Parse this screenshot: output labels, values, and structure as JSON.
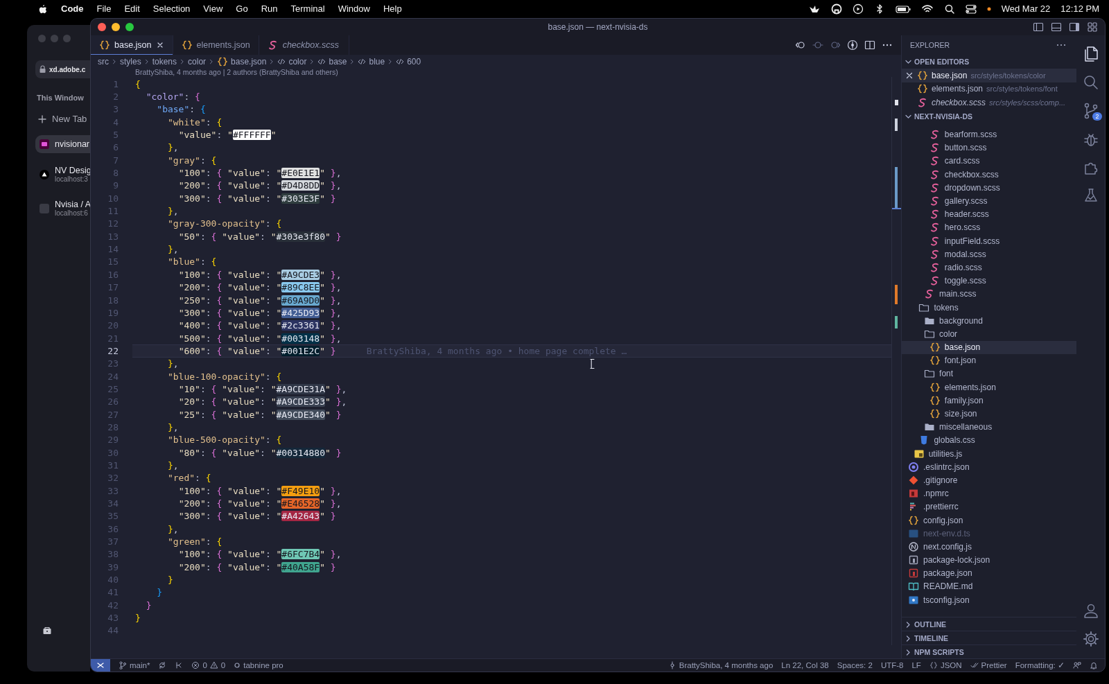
{
  "menubar": {
    "items": [
      {
        "label": "Code",
        "kind": "app"
      },
      {
        "label": "File",
        "kind": "menu"
      },
      {
        "label": "Edit",
        "kind": "menu"
      },
      {
        "label": "Selection",
        "kind": "menu"
      },
      {
        "label": "View",
        "kind": "menu"
      },
      {
        "label": "Go",
        "kind": "menu"
      },
      {
        "label": "Run",
        "kind": "menu"
      },
      {
        "label": "Terminal",
        "kind": "menu"
      },
      {
        "label": "Window",
        "kind": "menu"
      },
      {
        "label": "Help",
        "kind": "menu"
      }
    ],
    "date": "Wed Mar 22",
    "time": "12:12 PM"
  },
  "browser_sidebar": {
    "url": "xd.adobe.c",
    "section": "This Window",
    "new_tab": "New Tab",
    "tabs": [
      {
        "title": "nvisionar",
        "kind": "xd",
        "selected": true
      },
      {
        "title": "NV Desig",
        "subtitle": "localhost:3",
        "kind": "triangle",
        "selected": false
      },
      {
        "title": "Nvisia / A",
        "subtitle": "localhost:6",
        "kind": "blank",
        "selected": false
      }
    ]
  },
  "window": {
    "title": "base.json — next-nvisia-ds"
  },
  "tabs": [
    {
      "label": "base.json",
      "kind": "json",
      "selected": true,
      "preview": false
    },
    {
      "label": "elements.json",
      "kind": "json",
      "selected": false,
      "preview": false
    },
    {
      "label": "checkbox.scss",
      "kind": "scss",
      "selected": false,
      "preview": true
    }
  ],
  "breadcrumbs": [
    {
      "label": "src",
      "kind": "folder"
    },
    {
      "label": "styles",
      "kind": "folder"
    },
    {
      "label": "tokens",
      "kind": "folder"
    },
    {
      "label": "color",
      "kind": "folder"
    },
    {
      "label": "base.json",
      "kind": "json"
    },
    {
      "label": "color",
      "kind": "symbol"
    },
    {
      "label": "base",
      "kind": "symbol"
    },
    {
      "label": "blue",
      "kind": "symbol"
    },
    {
      "label": "600",
      "kind": "symbol"
    }
  ],
  "blame_header": "BrattyShiba, 4 months ago | 2 authors (BrattyShiba and others)",
  "lines": [
    {
      "number": "1",
      "code": "{",
      "current": false
    },
    {
      "number": "2",
      "code": "  \"color\": {",
      "current": false
    },
    {
      "number": "3",
      "code": "    \"base\": {",
      "current": false
    },
    {
      "number": "4",
      "code": "      \"white\": {",
      "current": false
    },
    {
      "number": "5",
      "code": "        \"value\": \"",
      "value": "#FFFFFF",
      "after": "\"",
      "color": "#ffffff",
      "current": false
    },
    {
      "number": "6",
      "code": "      },",
      "current": false
    },
    {
      "number": "7",
      "code": "      \"gray\": {",
      "current": false
    },
    {
      "number": "8",
      "code": "        \"100\": { \"value\": \"",
      "value": "#E0E1E1",
      "after": "\" },",
      "color": "#e0e1e1",
      "current": false
    },
    {
      "number": "9",
      "code": "        \"200\": { \"value\": \"",
      "value": "#D4D8DD",
      "after": "\" },",
      "color": "#d4d8dd",
      "current": false
    },
    {
      "number": "10",
      "code": "        \"300\": { \"value\": \"",
      "value": "#303E3F",
      "after": "\" }",
      "color": "#303e3f",
      "current": false
    },
    {
      "number": "11",
      "code": "      },",
      "current": false
    },
    {
      "number": "12",
      "code": "      \"gray-300-opacity\": {",
      "current": false
    },
    {
      "number": "13",
      "code": "        \"50\": { \"value\": \"",
      "value": "#303e3f80",
      "after": "\" }",
      "color": "#282f38",
      "current": false
    },
    {
      "number": "14",
      "code": "      },",
      "current": false
    },
    {
      "number": "15",
      "code": "      \"blue\": {",
      "current": false
    },
    {
      "number": "16",
      "code": "        \"100\": { \"value\": \"",
      "value": "#A9CDE3",
      "after": "\" },",
      "color": "#a9cde3",
      "current": false
    },
    {
      "number": "17",
      "code": "        \"200\": { \"value\": \"",
      "value": "#89C8EE",
      "after": "\" },",
      "color": "#89c8ee",
      "current": false
    },
    {
      "number": "18",
      "code": "        \"250\": { \"value\": \"",
      "value": "#69A9D0",
      "after": "\" },",
      "color": "#69a9d0",
      "current": false
    },
    {
      "number": "19",
      "code": "        \"300\": { \"value\": \"",
      "value": "#425D93",
      "after": "\" },",
      "color": "#425d93",
      "current": false
    },
    {
      "number": "20",
      "code": "        \"400\": { \"value\": \"",
      "value": "#2c3361",
      "after": "\" },",
      "color": "#2c3361",
      "current": false
    },
    {
      "number": "21",
      "code": "        \"500\": { \"value\": \"",
      "value": "#003148",
      "after": "\" },",
      "color": "#003148",
      "current": false
    },
    {
      "number": "22",
      "code": "        \"600\": { \"value\": \"",
      "value": "#001E2C",
      "after": "\" }",
      "color": "#001e2c",
      "current": true,
      "blame": "BrattyShiba, 4 months ago • home page complete …"
    },
    {
      "number": "23",
      "code": "      },",
      "current": false
    },
    {
      "number": "24",
      "code": "      \"blue-100-opacity\": {",
      "current": false
    },
    {
      "number": "25",
      "code": "        \"10\": { \"value\": \"",
      "value": "#A9CDE31A",
      "after": "\" },",
      "color": "#2f3646",
      "current": false
    },
    {
      "number": "26",
      "code": "        \"20\": { \"value\": \"",
      "value": "#A9CDE333",
      "after": "\" },",
      "color": "#3a4252",
      "current": false
    },
    {
      "number": "27",
      "code": "        \"25\": { \"value\": \"",
      "value": "#A9CDE340",
      "after": "\" }",
      "color": "#414b5a",
      "current": false
    },
    {
      "number": "28",
      "code": "      },",
      "current": false
    },
    {
      "number": "29",
      "code": "      \"blue-500-opacity\": {",
      "current": false
    },
    {
      "number": "30",
      "code": "        \"80\": { \"value\": \"",
      "value": "#00314880",
      "after": "\" }",
      "color": "#15283a",
      "current": false
    },
    {
      "number": "31",
      "code": "      },",
      "current": false
    },
    {
      "number": "32",
      "code": "      \"red\": {",
      "current": false
    },
    {
      "number": "33",
      "code": "        \"100\": { \"value\": \"",
      "value": "#F49E10",
      "after": "\" },",
      "color": "#f49e10",
      "current": false
    },
    {
      "number": "34",
      "code": "        \"200\": { \"value\": \"",
      "value": "#E46528",
      "after": "\" },",
      "color": "#e46528",
      "current": false
    },
    {
      "number": "35",
      "code": "        \"300\": { \"value\": \"",
      "value": "#A42643",
      "after": "\" }",
      "color": "#a42643",
      "current": false
    },
    {
      "number": "36",
      "code": "      },",
      "current": false
    },
    {
      "number": "37",
      "code": "      \"green\": {",
      "current": false
    },
    {
      "number": "38",
      "code": "        \"100\": { \"value\": \"",
      "value": "#6FC7B4",
      "after": "\" },",
      "color": "#6fc7b4",
      "current": false
    },
    {
      "number": "39",
      "code": "        \"200\": { \"value\": \"",
      "value": "#40A58F",
      "after": "\" }",
      "color": "#40a58f",
      "current": false
    },
    {
      "number": "40",
      "code": "      }",
      "current": false
    },
    {
      "number": "41",
      "code": "    }",
      "current": false
    },
    {
      "number": "42",
      "code": "  }",
      "current": false
    },
    {
      "number": "43",
      "code": "}",
      "current": false
    },
    {
      "number": "44",
      "current": false
    }
  ],
  "explorer": {
    "title": "EXPLORER",
    "open_editors": {
      "title": "OPEN EDITORS",
      "items": [
        {
          "label": "base.json",
          "path": "src/styles/tokens/color",
          "kind": "json",
          "selected": true,
          "preview": false
        },
        {
          "label": "elements.json",
          "path": "src/styles/tokens/font",
          "kind": "json",
          "selected": false,
          "preview": false
        },
        {
          "label": "checkbox.scss",
          "path": "src/styles/scss/comp...",
          "kind": "scss",
          "selected": false,
          "preview": true
        }
      ]
    },
    "project": {
      "title": "NEXT-NVISIA-DS",
      "tree": [
        {
          "children": [
            {
              "children": [
                {
                  "children": [
                    {
                      "children": [
                        {
                          "label": "bearform.scss",
                          "kind": "scss",
                          "selected": false
                        },
                        {
                          "label": "button.scss",
                          "kind": "scss",
                          "selected": false
                        },
                        {
                          "label": "card.scss",
                          "kind": "scss",
                          "selected": false
                        },
                        {
                          "label": "checkbox.scss",
                          "kind": "scss",
                          "selected": false
                        },
                        {
                          "label": "dropdown.scss",
                          "kind": "scss",
                          "selected": false
                        },
                        {
                          "label": "gallery.scss",
                          "kind": "scss",
                          "selected": false
                        },
                        {
                          "label": "header.scss",
                          "kind": "scss",
                          "selected": false
                        },
                        {
                          "label": "hero.scss",
                          "kind": "scss",
                          "selected": false
                        },
                        {
                          "label": "inputField.scss",
                          "kind": "scss",
                          "selected": false
                        },
                        {
                          "label": "modal.scss",
                          "kind": "scss",
                          "selected": false
                        },
                        {
                          "label": "radio.scss",
                          "kind": "scss",
                          "selected": false
                        },
                        {
                          "label": "toggle.scss",
                          "kind": "scss",
                          "selected": false
                        }
                      ]
                    },
                    {
                      "label": "main.scss",
                      "kind": "scss",
                      "selected": false
                    }
                  ]
                },
                {
                  "label": "tokens",
                  "kind": "folder",
                  "expanded": true,
                  "selected": false,
                  "children": [
                    {
                      "label": "background",
                      "kind": "folder",
                      "expanded": false,
                      "selected": false
                    },
                    {
                      "label": "color",
                      "kind": "folder",
                      "expanded": true,
                      "selected": false,
                      "children": [
                        {
                          "label": "base.json",
                          "kind": "json",
                          "selected": true
                        },
                        {
                          "label": "font.json",
                          "kind": "json",
                          "selected": false
                        }
                      ]
                    },
                    {
                      "label": "font",
                      "kind": "folder",
                      "expanded": true,
                      "selected": false,
                      "children": [
                        {
                          "label": "elements.json",
                          "kind": "json",
                          "selected": false
                        },
                        {
                          "label": "family.json",
                          "kind": "json",
                          "selected": false
                        },
                        {
                          "label": "size.json",
                          "kind": "json",
                          "selected": false
                        }
                      ]
                    },
                    {
                      "label": "miscellaneous",
                      "kind": "folder",
                      "expanded": false,
                      "selected": false
                    }
                  ]
                },
                {
                  "label": "globals.css",
                  "kind": "css",
                  "selected": false
                }
              ]
            },
            {
              "label": "utilities.js",
              "kind": "js",
              "selected": false
            }
          ]
        },
        {
          "label": ".eslintrc.json",
          "kind": "eslint",
          "selected": false,
          "ignored": false
        },
        {
          "label": ".gitignore",
          "kind": "git",
          "selected": false,
          "ignored": false
        },
        {
          "label": ".npmrc",
          "kind": "npm",
          "selected": false,
          "ignored": false
        },
        {
          "label": ".prettierrc",
          "kind": "prettier",
          "selected": false,
          "ignored": false
        },
        {
          "label": "config.json",
          "kind": "json",
          "selected": false,
          "ignored": false
        },
        {
          "label": "next-env.d.ts",
          "kind": "ts",
          "selected": false,
          "ignored": true
        },
        {
          "label": "next.config.js",
          "kind": "next",
          "selected": false,
          "ignored": false
        },
        {
          "label": "package-lock.json",
          "kind": "lock",
          "selected": false,
          "ignored": false
        },
        {
          "label": "package.json",
          "kind": "package",
          "selected": false,
          "ignored": false
        },
        {
          "label": "README.md",
          "kind": "readme",
          "selected": false,
          "ignored": false
        },
        {
          "label": "tsconfig.json",
          "kind": "tsconfig",
          "selected": false,
          "ignored": false
        }
      ]
    },
    "sections": [
      "OUTLINE",
      "TIMELINE",
      "NPM SCRIPTS"
    ]
  },
  "activity_bar": {
    "top": [
      {
        "kind": "files",
        "selected": true
      },
      {
        "kind": "search",
        "selected": false
      },
      {
        "kind": "source-control",
        "selected": false,
        "badge": "2"
      },
      {
        "kind": "debug",
        "selected": false
      },
      {
        "kind": "extensions",
        "selected": false
      },
      {
        "kind": "testing",
        "selected": false
      }
    ],
    "bottom": [
      {
        "kind": "account"
      },
      {
        "kind": "settings"
      }
    ]
  },
  "status_bar": {
    "branch": "main*",
    "errors": "0",
    "warnings": "0",
    "tabnine": "tabnine pro",
    "blame": "BrattyShiba, 4 months ago",
    "position": "Ln 22, Col 38",
    "spaces": "Spaces: 2",
    "encoding": "UTF-8",
    "eol": "LF",
    "language": "JSON",
    "formatter": "Prettier",
    "formatting": "Formatting: ✓"
  }
}
